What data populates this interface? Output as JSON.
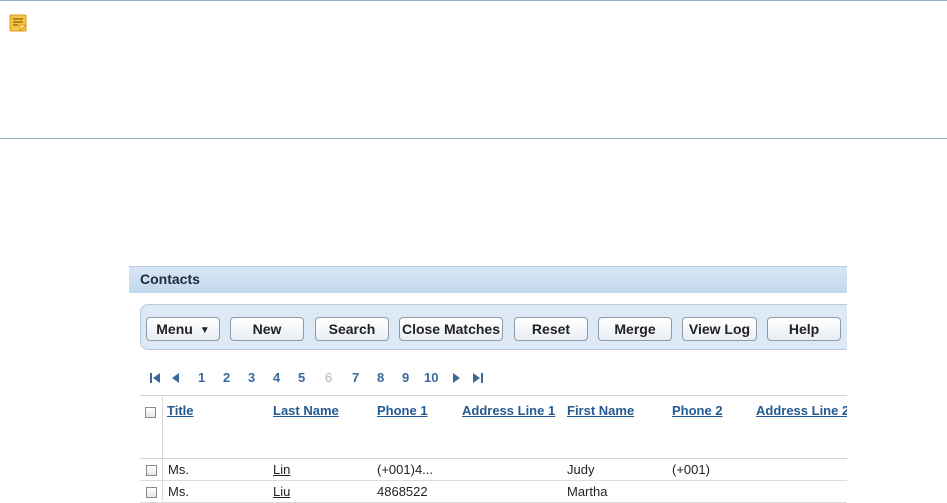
{
  "applet": {
    "title": "Contacts",
    "toolbar": {
      "menu": "Menu",
      "new": "New",
      "search": "Search",
      "close_matches": "Close Matches",
      "reset": "Reset",
      "merge": "Merge",
      "view_log": "View Log",
      "help": "Help"
    },
    "pager": {
      "pages": [
        "1",
        "2",
        "3",
        "4",
        "5",
        "6",
        "7",
        "8",
        "9",
        "10"
      ],
      "current_page": "6"
    },
    "columns": [
      "Title",
      "Last Name",
      "Phone 1",
      "Address Line 1",
      "First Name",
      "Phone 2",
      "Address Line 2"
    ],
    "rows": [
      {
        "title": "Ms.",
        "last_name": "Lin",
        "phone1": "(+001)4...",
        "address1": "",
        "first_name": "Judy",
        "phone2": "(+001)",
        "address2": ""
      },
      {
        "title": "Ms.",
        "last_name": "Liu",
        "phone1": "4868522",
        "address1": "",
        "first_name": "Martha",
        "phone2": "",
        "address2": ""
      }
    ]
  },
  "colors": {
    "link": "#245a94",
    "pager": "#3a6a9c",
    "title_bar": "#c2d8ee",
    "toolbar_bg": "#dde9f5",
    "note_icon": "#f0b432"
  },
  "icons": {
    "note": "note-icon",
    "first": "first-page-icon",
    "prev": "previous-page-icon",
    "next": "next-page-icon",
    "last": "last-page-icon"
  }
}
